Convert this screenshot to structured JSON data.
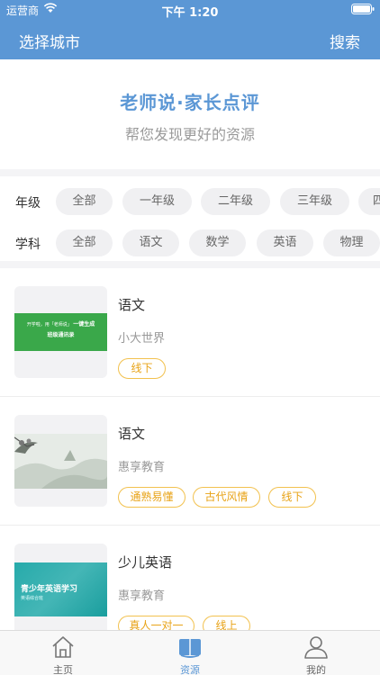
{
  "status_bar": {
    "carrier": "运营商",
    "time": "下午 1:20"
  },
  "nav": {
    "city": "选择城市",
    "search": "搜索"
  },
  "banner": {
    "title": "老师说·家长点评",
    "subtitle": "帮您发现更好的资源"
  },
  "filters": {
    "grade": {
      "label": "年级",
      "options": [
        "全部",
        "一年级",
        "二年级",
        "三年级",
        "四"
      ]
    },
    "subject": {
      "label": "学科",
      "options": [
        "全部",
        "语文",
        "数学",
        "英语",
        "物理"
      ]
    }
  },
  "resources": [
    {
      "title": "语文",
      "org": "小大世界",
      "tags": [
        "线下"
      ],
      "thumb": {
        "line1a": "开学啦，用「老师说」",
        "line1b": "一键生成",
        "line2": "班级通讯录",
        "color": "#3aa84a"
      }
    },
    {
      "title": "语文",
      "org": "惠享教育",
      "tags": [
        "通熟易懂",
        "古代风情",
        "线下"
      ],
      "thumb": {
        "style": "ink-landscape"
      }
    },
    {
      "title": "少儿英语",
      "org": "惠享教育",
      "tags": [
        "真人一对一",
        "线上"
      ],
      "thumb": {
        "line1": "青少年英语学习",
        "line2": "英语综合班",
        "color": "#1ba6a6"
      }
    }
  ],
  "tabs": [
    {
      "label": "主页",
      "icon": "home-icon",
      "active": false
    },
    {
      "label": "资源",
      "icon": "book-icon",
      "active": true
    },
    {
      "label": "我的",
      "icon": "user-icon",
      "active": false
    }
  ],
  "colors": {
    "primary": "#5b97d5",
    "tag": "#e8a317",
    "chip_bg": "#f0f0f2"
  }
}
